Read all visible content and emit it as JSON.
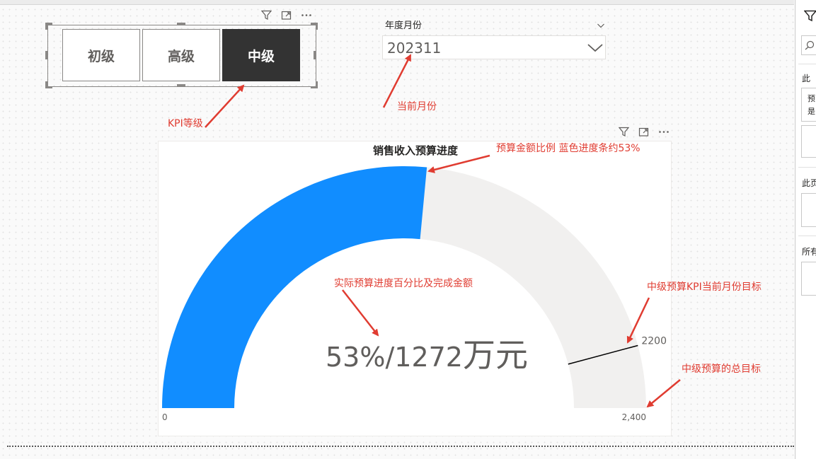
{
  "kpi_slicer": {
    "buttons": [
      {
        "label": "初级",
        "selected": false
      },
      {
        "label": "高级",
        "selected": false
      },
      {
        "label": "中级",
        "selected": true
      }
    ]
  },
  "month_slicer": {
    "title": "年度月份",
    "value": "202311"
  },
  "gauge": {
    "title": "销售收入预算进度",
    "min": 0,
    "min_label": "0",
    "max": 2400,
    "max_label": "2,400",
    "value": 1272,
    "target": 2200,
    "target_label": "2200",
    "callout_main": "53%/1272",
    "callout_unit": "万元",
    "fill_color": "#118dff",
    "track_color": "#f1f0ef"
  },
  "annotations": {
    "kpi_level": "KPI等级",
    "current_month": "当前月份",
    "budget_ratio": "预算金额比例 蓝色进度条约53%",
    "actual_progress": "实际预算进度百分比及完成金额",
    "kpi_target": "中级预算KPI当前月份目标",
    "total_target": "中级预算的总目标"
  },
  "right_pane": {
    "texts": [
      "此",
      "预",
      "是",
      "此页",
      "所有"
    ]
  }
}
